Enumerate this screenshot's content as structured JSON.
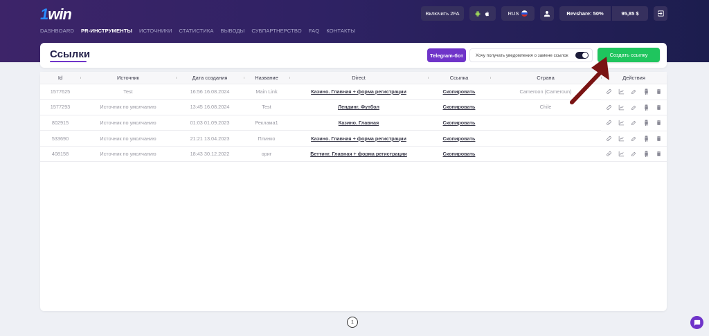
{
  "brand": {
    "logo_text": "1win"
  },
  "nav": {
    "items": [
      {
        "label": "DASHBOARD",
        "active": false
      },
      {
        "label": "PR-ИНСТРУМЕНТЫ",
        "active": true
      },
      {
        "label": "ИСТОЧНИКИ",
        "active": false
      },
      {
        "label": "СТАТИСТИКА",
        "active": false
      },
      {
        "label": "ВЫВОДЫ",
        "active": false
      },
      {
        "label": "СУБПАРТНЕРСТВО",
        "active": false
      },
      {
        "label": "FAQ",
        "active": false
      },
      {
        "label": "КОНТАКТЫ",
        "active": false
      }
    ]
  },
  "topbar": {
    "enable_2fa": "Включить 2FA",
    "language": "RUS",
    "revshare": "Revshare: 50%",
    "balance": "95,85 $"
  },
  "page": {
    "title": "Ссылки",
    "telegram_bot": "Telegram-бот",
    "notify_label": "Хочу получать уведомления о замене ссылок",
    "notify_enabled": true,
    "create_link": "Создать ссылку"
  },
  "table": {
    "headers": {
      "id": "Id",
      "source": "Источник",
      "created": "Дата создания",
      "name": "Название",
      "direct": "Direct",
      "link": "Ссылка",
      "country": "Страна",
      "actions": "Действия"
    },
    "rows": [
      {
        "id": "1577625",
        "source": "Test",
        "created": "16:56 16.08.2024",
        "name": "Main Link",
        "direct": "Казино. Главная + форма регистрации",
        "link": "Скопировать",
        "country": "Cameroon (Cameroun)"
      },
      {
        "id": "1577293",
        "source": "Источник по умолчанию",
        "created": "13:45 16.08.2024",
        "name": "Test",
        "direct": "Лендинг. Футбол",
        "link": "Скопировать",
        "country": "Chile"
      },
      {
        "id": "802915",
        "source": "Источник по умолчанию",
        "created": "01:03 01.09.2023",
        "name": "Реклама1",
        "direct": "Казино. Главная",
        "link": "Скопировать",
        "country": ""
      },
      {
        "id": "533690",
        "source": "Источник по умолчанию",
        "created": "21:21 13.04.2023",
        "name": "Плинко",
        "direct": "Казино. Главная + форма регистрации",
        "link": "Скопировать",
        "country": ""
      },
      {
        "id": "408158",
        "source": "Источник по умолчанию",
        "created": "18:43 30.12.2022",
        "name": "ориг",
        "direct": "Беттинг. Главная + форма регистрации",
        "link": "Скопировать",
        "country": ""
      }
    ]
  },
  "pagination": {
    "current": "1"
  },
  "colors": {
    "accent": "#6f34c9",
    "create_button": "#1fc55e",
    "header_bg": "#2f2264",
    "annotation_arrow": "#7a1414"
  }
}
